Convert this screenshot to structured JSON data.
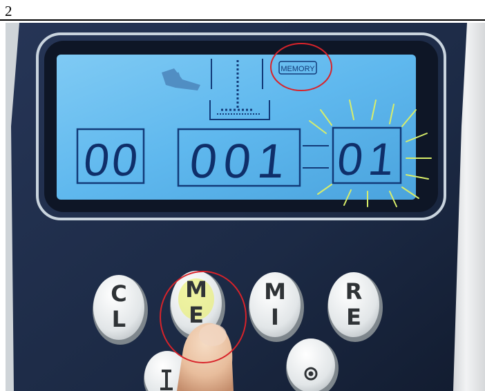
{
  "figure": {
    "step_number": "2"
  },
  "lcd": {
    "memory_indicator": "MEMORY",
    "left_digits": "00",
    "center_digits": "001",
    "right_digits": "01"
  },
  "buttons": [
    {
      "name": "cl-button",
      "top": "C",
      "bottom": "L"
    },
    {
      "name": "me-button",
      "top": "M",
      "bottom": "E"
    },
    {
      "name": "mi-button",
      "top": "M",
      "bottom": "I"
    },
    {
      "name": "re-button",
      "top": "R",
      "bottom": "E"
    }
  ],
  "colors": {
    "panel": "#1c2a45",
    "lcd_background": "#5fb8ee",
    "lcd_segment": "#0f2f6a",
    "highlight_circle": "#d8232a",
    "blink_rays": "#d8ee6a",
    "button_face": "#e6e9ea",
    "button_letter": "#2f3336"
  }
}
